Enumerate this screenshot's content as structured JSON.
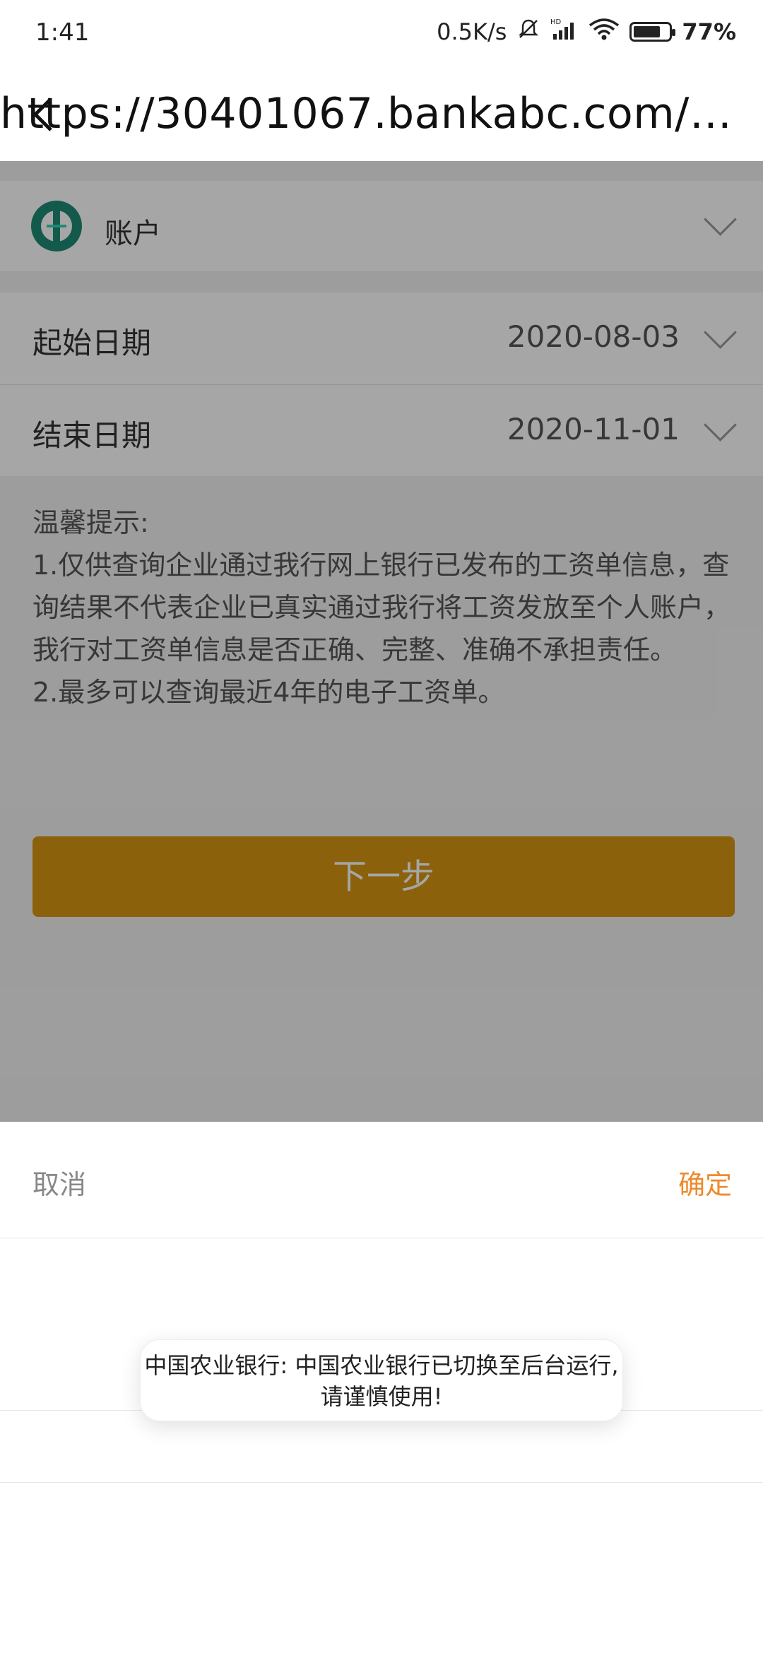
{
  "status_bar": {
    "time": "1:41",
    "net_speed": "0.5K/s",
    "battery_text": "77%",
    "battery_level": 0.77,
    "icons": [
      "mute-bell-icon",
      "hd-signal-icon",
      "wifi-icon",
      "battery-icon"
    ]
  },
  "browser": {
    "url": "https://30401067.bankabc.com/www/i…",
    "back_icon": "back-arrow-icon"
  },
  "account": {
    "label": "账户",
    "logo": "abc-bank-logo"
  },
  "dates": {
    "start_label": "起始日期",
    "start_value": "2020-08-03",
    "end_label": "结束日期",
    "end_value": "2020-11-01"
  },
  "tips": {
    "title": "温馨提示:",
    "line1": "1.仅供查询企业通过我行网上银行已发布的工资单信息，查询结果不代表企业已真实通过我行将工资发放至个人账户，我行对工资单信息是否正确、完整、准确不承担责任。",
    "line2": "2.最多可以查询最近4年的电子工资单。"
  },
  "next_button": "下一步",
  "picker": {
    "cancel": "取消",
    "confirm": "确定"
  },
  "toast": {
    "text": "中国农业银行: 中国农业银行已切换至后台运行,请谨慎使用!"
  },
  "colors": {
    "primary_button": "#d69613",
    "confirm_text": "#ee8a2e",
    "logo_green": "#1e8a76"
  }
}
